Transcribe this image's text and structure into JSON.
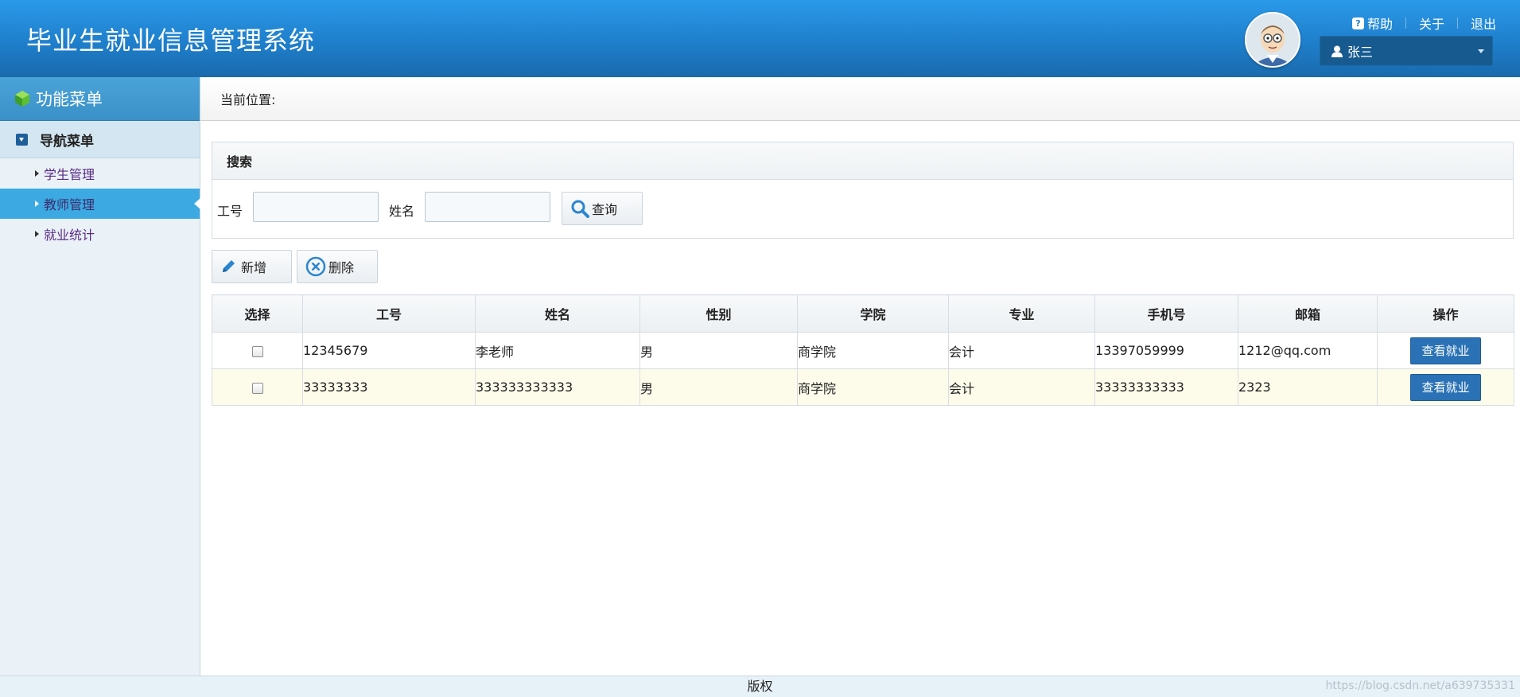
{
  "header": {
    "title": "毕业生就业信息管理系统",
    "help": "帮助",
    "about": "关于",
    "logout": "退出",
    "user": "张三"
  },
  "sidebar": {
    "title": "功能菜单",
    "nav_header": "导航菜单",
    "items": [
      {
        "label": "学生管理",
        "active": false
      },
      {
        "label": "教师管理",
        "active": true
      },
      {
        "label": "就业统计",
        "active": false
      }
    ]
  },
  "location": {
    "label": "当前位置:"
  },
  "search": {
    "title": "搜索",
    "id_label": "工号",
    "name_label": "姓名",
    "id_value": "",
    "name_value": "",
    "query_button": "查询"
  },
  "toolbar": {
    "add": "新增",
    "delete": "删除"
  },
  "table": {
    "headers": [
      "选择",
      "工号",
      "姓名",
      "性别",
      "学院",
      "专业",
      "手机号",
      "邮箱",
      "操作"
    ],
    "action_label": "查看就业",
    "rows": [
      {
        "id": "12345679",
        "name": "李老师",
        "gender": "男",
        "college": "商学院",
        "major": "会计",
        "phone": "13397059999",
        "email": "1212@qq.com"
      },
      {
        "id": "33333333",
        "name": "333333333333",
        "gender": "男",
        "college": "商学院",
        "major": "会计",
        "phone": "33333333333",
        "email": "2323"
      }
    ]
  },
  "footer": {
    "copyright": "版权"
  },
  "watermark": "https://blog.csdn.net/a639735331",
  "colors": {
    "header": "#1f7fcc",
    "accent": "#3ca9e2",
    "action_button": "#2a72b5"
  }
}
